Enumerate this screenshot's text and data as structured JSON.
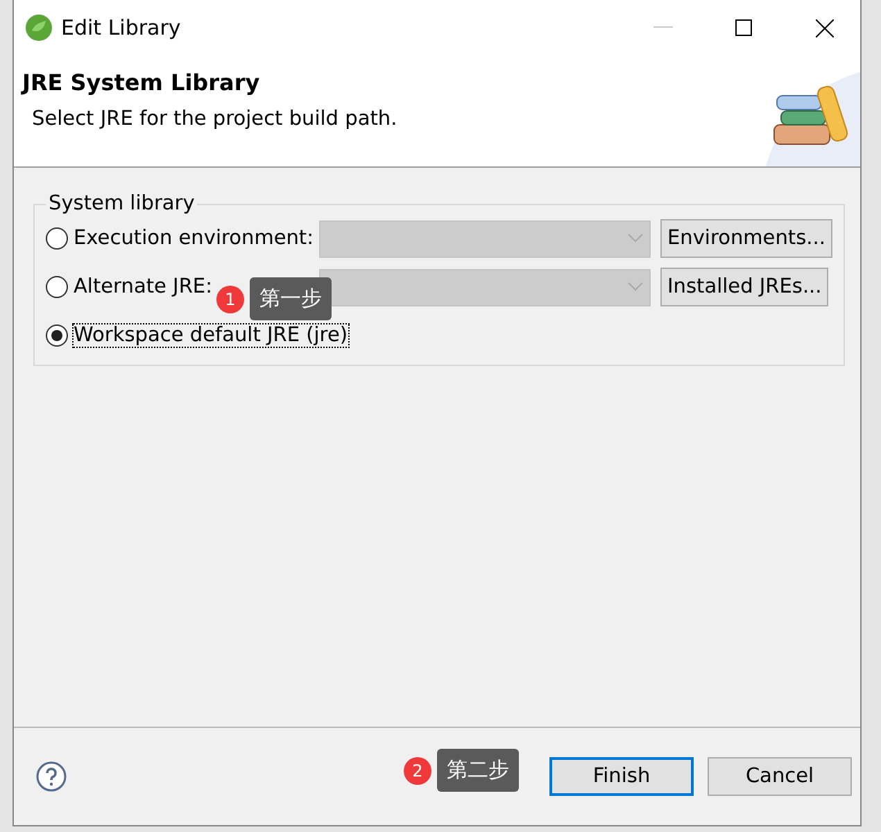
{
  "window": {
    "title": "Edit Library"
  },
  "header": {
    "title": "JRE System Library",
    "subtitle": "Select JRE for the project build path."
  },
  "group": {
    "title": "System library",
    "options": [
      {
        "label": "Execution environment:",
        "selected": false,
        "combo": true,
        "button": "Environments..."
      },
      {
        "label": "Alternate JRE:",
        "selected": false,
        "combo": true,
        "button": "Installed JREs..."
      },
      {
        "label": "Workspace default JRE (jre)",
        "selected": true,
        "combo": false
      }
    ]
  },
  "annotations": [
    {
      "number": "1",
      "text": "第一步"
    },
    {
      "number": "2",
      "text": "第二步"
    }
  ],
  "buttons": [
    {
      "label": "Finish",
      "default": true
    },
    {
      "label": "Cancel",
      "default": false
    }
  ]
}
